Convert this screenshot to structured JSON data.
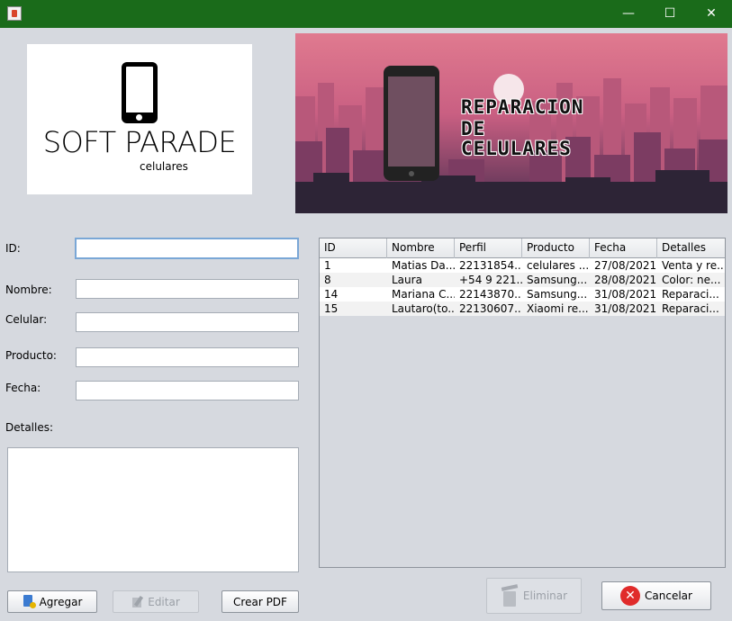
{
  "window": {
    "minimize_glyph": "—",
    "maximize_glyph": "☐",
    "close_glyph": "✕"
  },
  "logo": {
    "title": "SOFT PARADE",
    "subtitle": "celulares"
  },
  "banner": {
    "line1": "REPARACION",
    "line2": "DE",
    "line3": "CELULARES"
  },
  "form": {
    "id_label": "ID:",
    "nombre_label": "Nombre:",
    "celular_label": "Celular:",
    "producto_label": "Producto:",
    "fecha_label": "Fecha:",
    "detalles_label": "Detalles:",
    "id_value": "",
    "nombre_value": "",
    "celular_value": "",
    "producto_value": "",
    "fecha_value": ""
  },
  "table": {
    "columns": [
      "ID",
      "Nombre",
      "Perfil",
      "Producto",
      "Fecha",
      "Detalles"
    ],
    "rows": [
      [
        "1",
        "Matias Da...",
        "22131854...",
        "celulares ...",
        "27/08/2021",
        "Venta y re..."
      ],
      [
        "8",
        "Laura",
        "+54 9 221...",
        "Samsung...",
        "28/08/2021",
        "Color: ne..."
      ],
      [
        "14",
        "Mariana C...",
        "22143870...",
        "Samsung...",
        "31/08/2021",
        "Reparaci..."
      ],
      [
        "15",
        "Lautaro(to...",
        "22130607...",
        "Xiaomi re...",
        "31/08/2021",
        "Reparaci..."
      ]
    ]
  },
  "buttons": {
    "agregar": "Agregar",
    "editar": "Editar",
    "crear_pdf": "Crear PDF",
    "eliminar": "Eliminar",
    "cancelar": "Cancelar",
    "cancel_glyph": "✕"
  },
  "colors": {
    "titlebar": "#1a6b1a",
    "background": "#d6d9df",
    "cancel_red": "#e02b2b"
  }
}
